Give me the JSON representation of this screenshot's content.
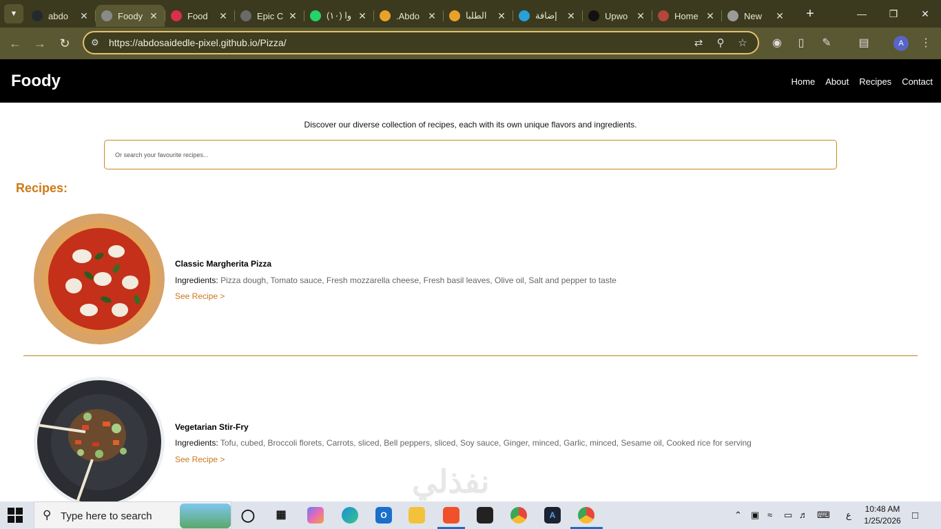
{
  "browser": {
    "tabs": [
      {
        "label": "abdo",
        "icon": "github-icon"
      },
      {
        "label": "Foody",
        "icon": "globe-icon",
        "active": true
      },
      {
        "label": "Food",
        "icon": "record-icon"
      },
      {
        "label": "Epic C",
        "icon": "monitor-icon"
      },
      {
        "label": "(١٠) وا",
        "icon": "whatsapp-icon"
      },
      {
        "label": ".Abdo",
        "icon": "html5-icon"
      },
      {
        "label": "الطلبا",
        "icon": "html5-icon"
      },
      {
        "label": "إضافة",
        "icon": "circle-icon"
      },
      {
        "label": "Upwo",
        "icon": "upwork-icon"
      },
      {
        "label": "Home",
        "icon": "crab-icon"
      },
      {
        "label": "New",
        "icon": "chrome-icon"
      }
    ],
    "new_tab_symbol": "+",
    "url": "https://abdosaidedle-pixel.github.io/Pizza/",
    "profile_initial": "A"
  },
  "site": {
    "logo": "Foody",
    "nav": [
      "Home",
      "About",
      "Recipes",
      "Contact"
    ],
    "intro": "Discover our diverse collection of recipes, each with its own unique flavors and ingredients.",
    "search_placeholder": "Or search your favourite recipes...",
    "section_title": "Recipes:",
    "recipes": [
      {
        "name": "Classic Margherita Pizza",
        "ingredients_label": "Ingredients:",
        "ingredients": "Pizza dough, Tomato sauce, Fresh mozzarella cheese, Fresh basil leaves, Olive oil, Salt and pepper to taste",
        "link": "See Recipe >"
      },
      {
        "name": "Vegetarian Stir-Fry",
        "ingredients_label": "Ingredients:",
        "ingredients": "Tofu, cubed, Broccoli florets, Carrots, sliced, Bell peppers, sliced, Soy sauce, Ginger, minced, Garlic, minced, Sesame oil, Cooked rice for serving",
        "link": "See Recipe >"
      }
    ]
  },
  "watermark": "نفذلي",
  "taskbar": {
    "search_placeholder": "Type here to search",
    "time": "10:48 AM",
    "date": "1/25/2026",
    "lang": "ع"
  },
  "colors": {
    "accent": "#cf7a14",
    "tabbar": "#3b3a1e",
    "toolbar": "#5a5832",
    "omnibox_border": "#e3c36a"
  }
}
